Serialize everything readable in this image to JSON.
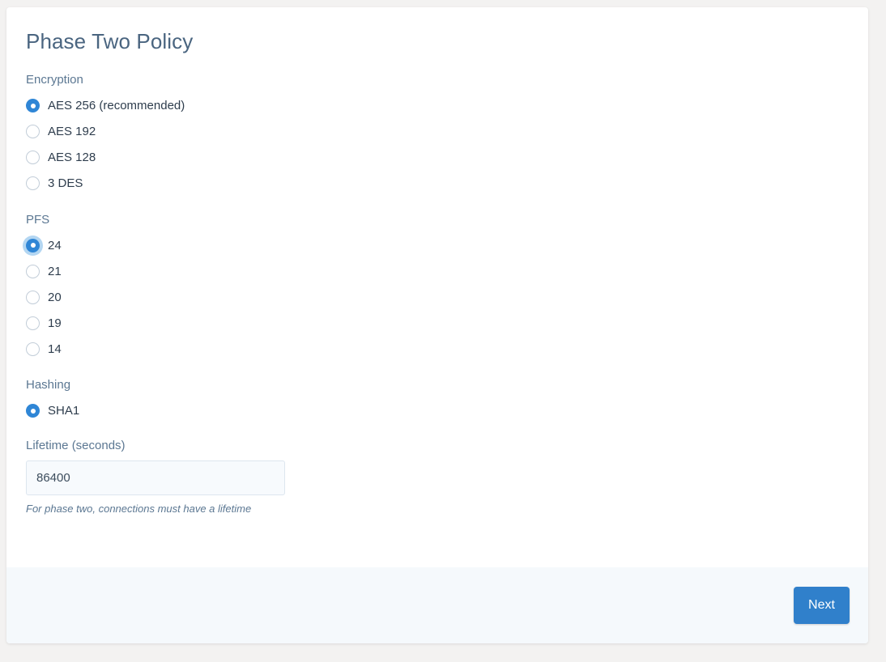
{
  "page": {
    "title": "Phase Two Policy"
  },
  "encryption": {
    "label": "Encryption",
    "options": [
      {
        "label": "AES 256 (recommended)",
        "checked": true,
        "focused": false
      },
      {
        "label": "AES 192",
        "checked": false,
        "focused": false
      },
      {
        "label": "AES 128",
        "checked": false,
        "focused": false
      },
      {
        "label": "3 DES",
        "checked": false,
        "focused": false
      }
    ]
  },
  "pfs": {
    "label": "PFS",
    "options": [
      {
        "label": "24",
        "checked": true,
        "focused": true
      },
      {
        "label": "21",
        "checked": false,
        "focused": false
      },
      {
        "label": "20",
        "checked": false,
        "focused": false
      },
      {
        "label": "19",
        "checked": false,
        "focused": false
      },
      {
        "label": "14",
        "checked": false,
        "focused": false
      }
    ]
  },
  "hashing": {
    "label": "Hashing",
    "options": [
      {
        "label": "SHA1",
        "checked": true,
        "focused": false
      }
    ]
  },
  "lifetime": {
    "label": "Lifetime (seconds)",
    "value": "86400",
    "placeholder": "",
    "help": "For phase two, connections must have a lifetime"
  },
  "footer": {
    "next_label": "Next"
  },
  "colors": {
    "accent": "#3080cb",
    "radio_selected": "#2f86d6",
    "title": "#4a6580",
    "label": "#5b7792",
    "footer_bg": "#f5f9fc",
    "page_bg": "#f3f2f1"
  }
}
